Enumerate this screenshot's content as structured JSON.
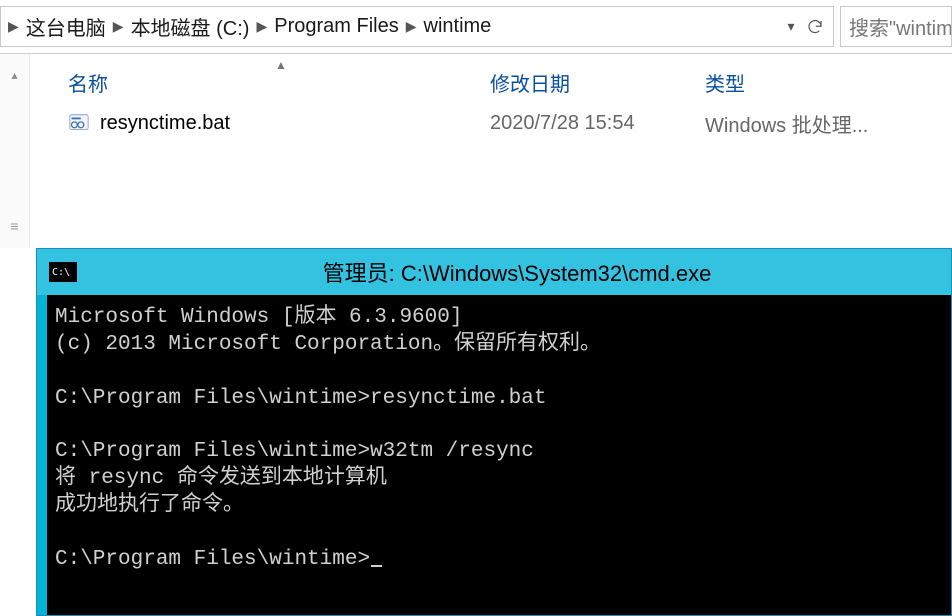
{
  "breadcrumb": {
    "items": [
      {
        "label": "这台电脑"
      },
      {
        "label": "本地磁盘 (C:)"
      },
      {
        "label": "Program Files"
      },
      {
        "label": "wintime"
      }
    ]
  },
  "search": {
    "placeholder": "搜索\"wintime"
  },
  "columns": {
    "name": "名称",
    "date": "修改日期",
    "type": "类型"
  },
  "files": [
    {
      "name": "resynctime.bat",
      "date": "2020/7/28 15:54",
      "type": "Windows 批处理..."
    }
  ],
  "cmd": {
    "title": "管理员: C:\\Windows\\System32\\cmd.exe",
    "icon_label": "C:\\",
    "lines": {
      "l1": "Microsoft Windows [版本 6.3.9600]",
      "l2": "(c) 2013 Microsoft Corporation。保留所有权利。",
      "blank1": "",
      "l3": "C:\\Program Files\\wintime>resynctime.bat",
      "blank2": "",
      "l4": "C:\\Program Files\\wintime>w32tm /resync",
      "l5": "将 resync 命令发送到本地计算机",
      "l6": "成功地执行了命令。",
      "blank3": "",
      "l7": "C:\\Program Files\\wintime>"
    }
  }
}
